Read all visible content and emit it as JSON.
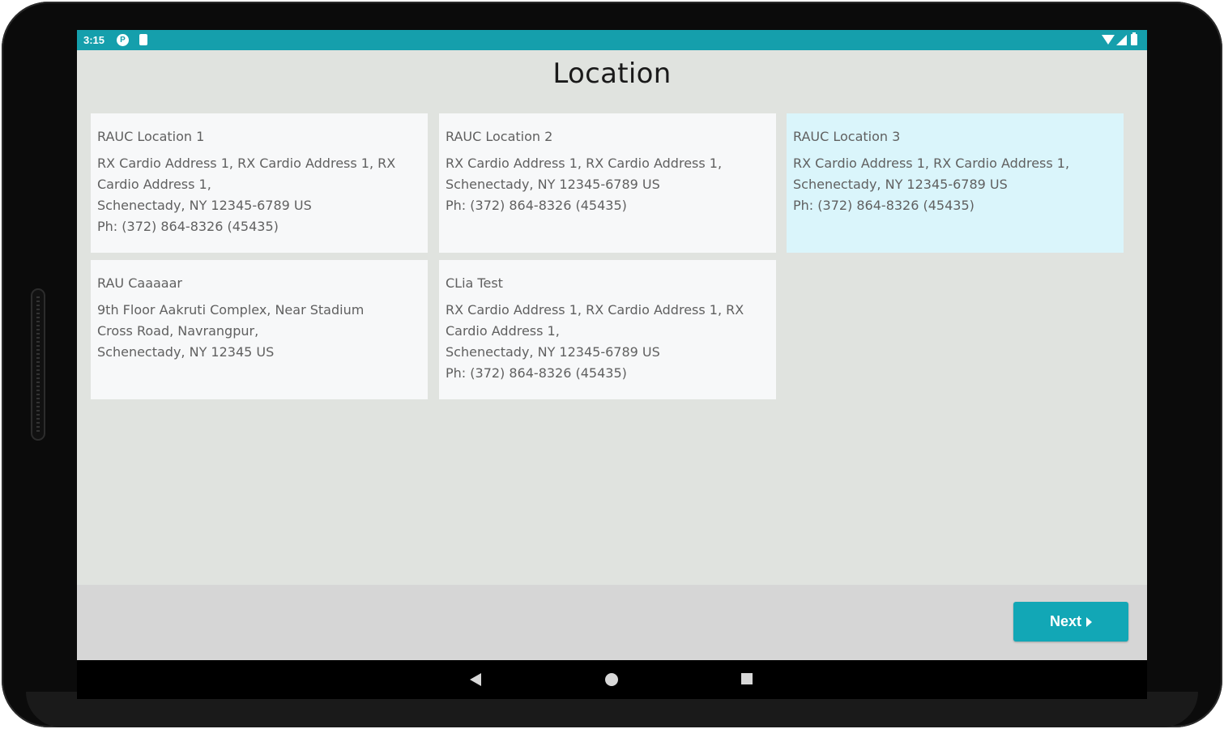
{
  "status_bar": {
    "time": "3:15",
    "icons": [
      "notification-p-icon",
      "clipboard-icon",
      "wifi-icon",
      "signal-icon",
      "battery-icon"
    ],
    "color": "#159fac"
  },
  "page": {
    "title": "Location"
  },
  "locations": [
    {
      "name": "RAUC Location 1",
      "address_line1": "RX Cardio Address 1, RX Cardio Address 1, RX",
      "address_line2": "Cardio Address 1,",
      "address_line3": "Schenectady, NY 12345-6789 US",
      "phone": "Ph: (372) 864-8326 (45435)",
      "selected": false
    },
    {
      "name": "RAUC Location 2",
      "address_line1": "RX Cardio Address 1, RX Cardio Address 1,",
      "address_line2": "Schenectady, NY 12345-6789 US",
      "address_line3": "",
      "phone": "Ph: (372) 864-8326 (45435)",
      "selected": false
    },
    {
      "name": "RAUC Location 3",
      "address_line1": "RX Cardio Address 1, RX Cardio Address 1,",
      "address_line2": "Schenectady, NY 12345-6789 US",
      "address_line3": "",
      "phone": "Ph: (372) 864-8326 (45435)",
      "selected": true
    },
    {
      "name": "RAU Caaaaar",
      "address_line1": "9th Floor Aakruti Complex, Near Stadium",
      "address_line2": "Cross Road, Navrangpur,",
      "address_line3": "Schenectady, NY 12345 US",
      "phone": "",
      "selected": false
    },
    {
      "name": "CLia Test",
      "address_line1": "RX Cardio Address 1, RX Cardio Address 1, RX",
      "address_line2": "Cardio Address 1,",
      "address_line3": "Schenectady, NY 12345-6789 US",
      "phone": "Ph: (372) 864-8326 (45435)",
      "selected": false
    }
  ],
  "footer": {
    "next_label": "Next"
  },
  "colors": {
    "accent": "#12a7b6",
    "selected_card": "#daf5fb",
    "card": "#f7f8f9",
    "background": "#e0e3df"
  },
  "navigation_bar": {
    "icons": [
      "back-icon",
      "home-icon",
      "recents-icon"
    ]
  }
}
